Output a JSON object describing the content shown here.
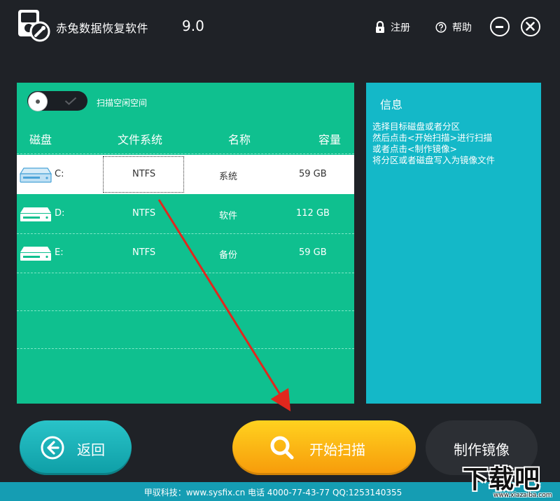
{
  "app": {
    "title": "赤兔数据恢复软件",
    "version": "9.0",
    "logo_icon": "hard-drive-wrench-icon"
  },
  "top_actions": {
    "register": {
      "label": "注册",
      "icon": "lock-icon"
    },
    "help": {
      "label": "帮助",
      "icon": "question-circle-icon"
    }
  },
  "window_controls": {
    "minimize_icon": "minimize-icon",
    "close_icon": "close-icon"
  },
  "disk_panel": {
    "toggle_label": "扫描空闲空间",
    "toggle_on": false,
    "headers": [
      "磁盘",
      "文件系统",
      "名称",
      "容量"
    ],
    "rows": [
      {
        "drive": "C:",
        "fs": "NTFS",
        "name": "系统",
        "size": "59 GB",
        "selected": true
      },
      {
        "drive": "D:",
        "fs": "NTFS",
        "name": "软件",
        "size": "112 GB",
        "selected": false
      },
      {
        "drive": "E:",
        "fs": "NTFS",
        "name": "备份",
        "size": "59 GB",
        "selected": false
      }
    ],
    "colors": {
      "panel": "#0fc08f",
      "selected_row": "#ffffff"
    }
  },
  "info_panel": {
    "title": "信息",
    "lines": [
      "选择目标磁盘或者分区",
      "然后点击<开始扫描>进行扫描",
      "或者点击<制作镜像>",
      "将分区或者磁盘写入为镜像文件"
    ],
    "color": "#14b8c8"
  },
  "buttons": {
    "back": "返回",
    "scan": "开始扫描",
    "image": "制作镜像"
  },
  "footer": {
    "text": "甲驭科技：www.sysfix.cn 电话 4000-77-43-77 QQ:1253140355"
  },
  "watermark": {
    "big": "下载吧",
    "small": "www.xiazaiba.com"
  }
}
